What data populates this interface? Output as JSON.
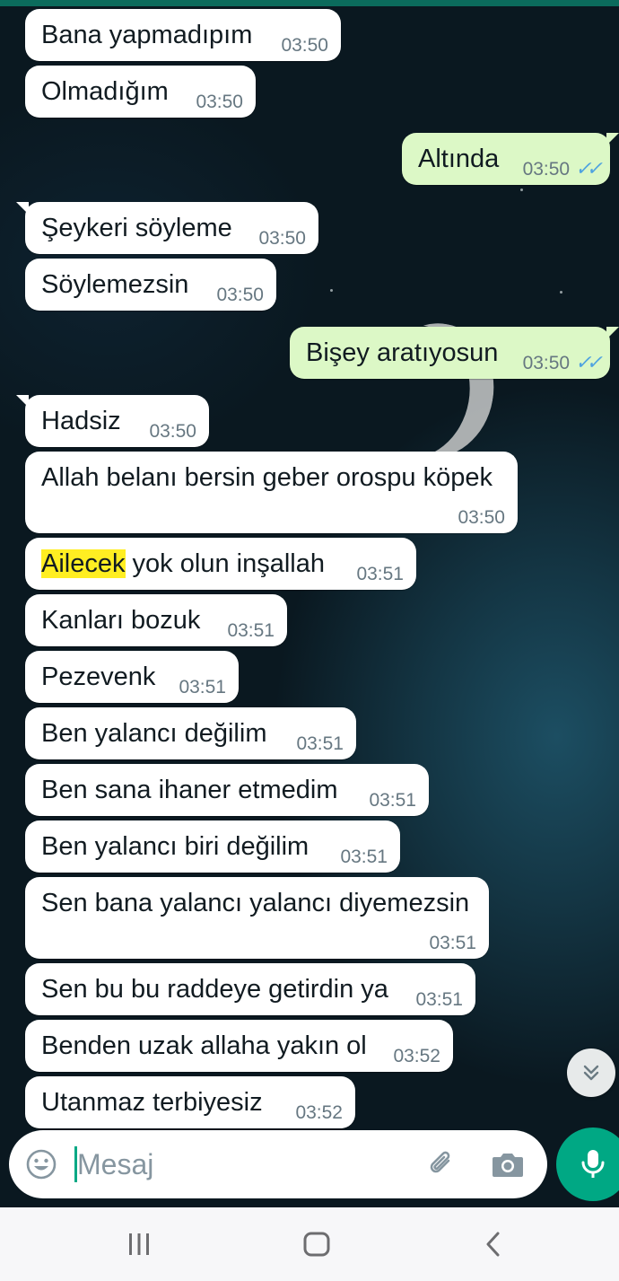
{
  "messages": [
    {
      "text": "Bana yapmadıpım",
      "time": "03:50",
      "direction": "in"
    },
    {
      "text": "Olmadığım",
      "time": "03:50",
      "direction": "in"
    },
    {
      "text": "Altında",
      "time": "03:50",
      "direction": "out",
      "status": "read"
    },
    {
      "text": "Şeykeri söyleme",
      "time": "03:50",
      "direction": "in"
    },
    {
      "text": "Söylemezsin",
      "time": "03:50",
      "direction": "in"
    },
    {
      "text": "Bişey aratıyosun",
      "time": "03:50",
      "direction": "out",
      "status": "read"
    },
    {
      "text": "Hadsiz",
      "time": "03:50",
      "direction": "in"
    },
    {
      "text": "Allah belanı bersin geber orospu köpek",
      "time": "03:50",
      "direction": "in"
    },
    {
      "highlight": "Ailecek",
      "text_rest": " yok olun inşallah",
      "time": "03:51",
      "direction": "in"
    },
    {
      "text": "Kanları bozuk",
      "time": "03:51",
      "direction": "in"
    },
    {
      "text": "Pezevenk",
      "time": "03:51",
      "direction": "in"
    },
    {
      "text": "Ben yalancı değilim",
      "time": "03:51",
      "direction": "in"
    },
    {
      "text": "Ben sana ihaner etmedim",
      "time": "03:51",
      "direction": "in"
    },
    {
      "text": "Ben yalancı biri değilim",
      "time": "03:51",
      "direction": "in"
    },
    {
      "text": "Sen bana yalancı yalancı diyemezsin",
      "time": "03:51",
      "direction": "in"
    },
    {
      "text": "Sen bu bu raddeye getirdin ya",
      "time": "03:51",
      "direction": "in"
    },
    {
      "text": "Benden uzak allaha yakın ol",
      "time": "03:52",
      "direction": "in"
    },
    {
      "text": "Utanmaz terbiyesiz",
      "time": "03:52",
      "direction": "in"
    }
  ],
  "composer": {
    "placeholder": "Mesaj",
    "emoji_icon": "emoji-icon",
    "attach_icon": "paperclip-icon",
    "camera_icon": "camera-icon",
    "mic_icon": "microphone-icon"
  },
  "scroll_button_icon": "double-chevron-down-icon",
  "navbar": {
    "recent_icon": "recent-apps-icon",
    "home_icon": "home-icon",
    "back_icon": "back-icon"
  },
  "colors": {
    "incoming_bubble": "#ffffff",
    "outgoing_bubble": "#dcf8c6",
    "read_ticks": "#4fa3e0",
    "accent": "#00a884",
    "highlight": "#ffee22"
  }
}
